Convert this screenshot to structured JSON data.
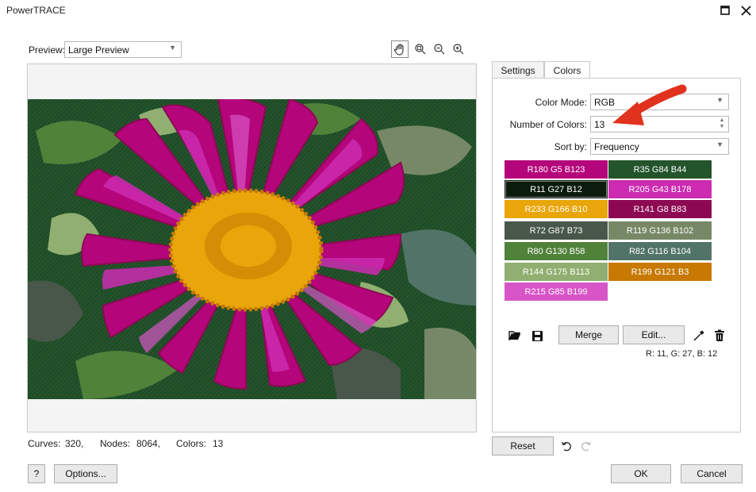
{
  "window": {
    "title": "PowerTRACE",
    "maximize_icon": "maximize-icon",
    "close_icon": "close-icon"
  },
  "preview": {
    "label": "Preview:",
    "selected": "Large Preview"
  },
  "toolbar": {
    "icons": [
      "pan-hand-icon",
      "zoom-fit-icon",
      "zoom-out-icon",
      "zoom-in-icon"
    ]
  },
  "status": {
    "curves_label": "Curves:",
    "curves_value": "320,",
    "nodes_label": "Nodes:",
    "nodes_value": "8064,",
    "colors_label": "Colors:",
    "colors_value": "13"
  },
  "tabs": {
    "settings": "Settings",
    "colors": "Colors",
    "active": "Colors"
  },
  "colors_panel": {
    "color_mode_label": "Color Mode:",
    "color_mode_value": "RGB",
    "number_of_colors_label": "Number of Colors:",
    "number_of_colors_value": "13",
    "sort_by_label": "Sort by:",
    "sort_by_value": "Frequency",
    "swatches": [
      {
        "label": "R180 G5 B123",
        "color": "#b4057b",
        "text": "#ffffff"
      },
      {
        "label": "R35 G84 B44",
        "color": "#23542c",
        "text": "#ffffff"
      },
      {
        "label": "R11 G27 B12",
        "color": "#0b1b0c",
        "text": "#ffffff"
      },
      {
        "label": "R205 G43 B178",
        "color": "#cd2bb2",
        "text": "#ffffff"
      },
      {
        "label": "R233 G166 B10",
        "color": "#e9a60a",
        "text": "#ffffff"
      },
      {
        "label": "R141 G8 B83",
        "color": "#8d0853",
        "text": "#ffffff"
      },
      {
        "label": "R72 G87 B73",
        "color": "#485749",
        "text": "#ffffff"
      },
      {
        "label": "R119 G136 B102",
        "color": "#778866",
        "text": "#ffffff"
      },
      {
        "label": "R80 G130 B58",
        "color": "#50823a",
        "text": "#ffffff"
      },
      {
        "label": "R82 G116 B104",
        "color": "#527468",
        "text": "#ffffff"
      },
      {
        "label": "R144 G175 B113",
        "color": "#90af71",
        "text": "#ffffff"
      },
      {
        "label": "R199 G121 B3",
        "color": "#c77903",
        "text": "#ffffff"
      },
      {
        "label": "R215 G85 B199",
        "color": "#d755c7",
        "text": "#ffffff"
      }
    ],
    "merge_button": "Merge",
    "edit_button": "Edit...",
    "readout": "R: 11, G: 27, B: 12",
    "icons": [
      "open-folder-icon",
      "save-icon",
      "eyedropper-icon",
      "trash-icon"
    ]
  },
  "footer": {
    "reset_button": "Reset",
    "help_button": "?",
    "options_button": "Options...",
    "ok_button": "OK",
    "cancel_button": "Cancel",
    "icons": [
      "undo-icon",
      "redo-icon"
    ]
  },
  "annotation": {
    "arrow_color": "#e0321c"
  }
}
